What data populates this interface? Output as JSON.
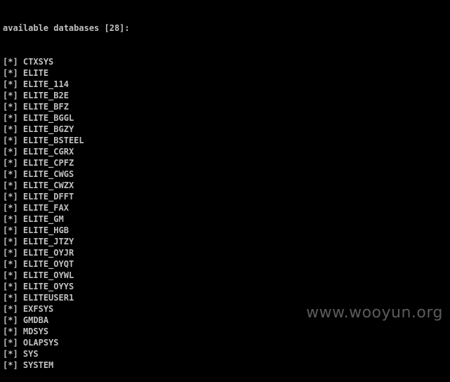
{
  "console": {
    "header": "available databases [28]:",
    "bullet": "[*]",
    "databases": [
      "CTXSYS",
      "ELITE",
      "ELITE_114",
      "ELITE_B2E",
      "ELITE_BFZ",
      "ELITE_BGGL",
      "ELITE_BGZY",
      "ELITE_BSTEEL",
      "ELITE_CGRX",
      "ELITE_CPFZ",
      "ELITE_CWGS",
      "ELITE_CWZX",
      "ELITE_DFFT",
      "ELITE_FAX",
      "ELITE_GM",
      "ELITE_HGB",
      "ELITE_JTZY",
      "ELITE_OYJR",
      "ELITE_OYQT",
      "ELITE_OYWL",
      "ELITE_OYYS",
      "ELITEUSER1",
      "EXFSYS",
      "GMDBA",
      "MDSYS",
      "OLAPSYS",
      "SYS",
      "SYSTEM"
    ]
  },
  "watermark": "www.wooyun.org",
  "colors": {
    "background": "#000000",
    "text": "#c0c0c0",
    "watermark": "#7a7a7a"
  }
}
